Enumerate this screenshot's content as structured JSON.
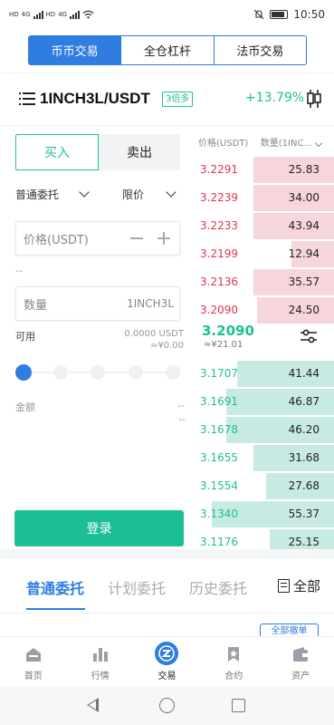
{
  "status_bar": {
    "left_tags": [
      "HD",
      "4G",
      "HD",
      "4G"
    ],
    "time": "10:50"
  },
  "top_tabs": [
    {
      "label": "币币交易",
      "active": true
    },
    {
      "label": "全仓杠杆",
      "active": false
    },
    {
      "label": "法币交易",
      "active": false
    }
  ],
  "pair": {
    "name": "1INCH3L/USDT",
    "leverage_badge": "3倍多",
    "change": "+13.79%"
  },
  "order_form": {
    "buy_label": "买入",
    "sell_label": "卖出",
    "order_type": "普通委托",
    "price_type": "限价",
    "price_placeholder": "价格(USDT)",
    "price_hint": "--",
    "amount_placeholder": "数量",
    "amount_unit": "1INCH3L",
    "available_label": "可用",
    "available_value": "0.0000 USDT",
    "available_cny": "≈¥0.00",
    "total_label": "金额",
    "total_value": "--",
    "total_sub": "--",
    "slider_position": 0,
    "login_label": "登录"
  },
  "order_book": {
    "header_price": "价格(USDT)",
    "header_qty": "数量(1INC...",
    "asks": [
      {
        "price": "3.2291",
        "qty": "25.83",
        "depth": 0.59
      },
      {
        "price": "3.2239",
        "qty": "34.00",
        "depth": 0.59
      },
      {
        "price": "3.2233",
        "qty": "43.94",
        "depth": 0.59
      },
      {
        "price": "3.2199",
        "qty": "12.94",
        "depth": 0.31
      },
      {
        "price": "3.2136",
        "qty": "35.57",
        "depth": 0.59
      },
      {
        "price": "3.2090",
        "qty": "24.50",
        "depth": 0.57
      }
    ],
    "last_price": "3.2090",
    "last_price_cny": "≈¥21.01",
    "bids": [
      {
        "price": "3.1707",
        "qty": "41.44",
        "depth": 0.71
      },
      {
        "price": "3.1691",
        "qty": "46.87",
        "depth": 0.79
      },
      {
        "price": "3.1678",
        "qty": "46.20",
        "depth": 0.79
      },
      {
        "price": "3.1655",
        "qty": "31.68",
        "depth": 0.59
      },
      {
        "price": "3.1554",
        "qty": "27.68",
        "depth": 0.5
      },
      {
        "price": "3.1340",
        "qty": "55.37",
        "depth": 0.9
      },
      {
        "price": "3.1176",
        "qty": "25.15",
        "depth": 0.47
      }
    ]
  },
  "order_tabs": {
    "items": [
      "普通委托",
      "计划委托",
      "历史委托"
    ],
    "active": 0,
    "all_label": "全部",
    "cancel_all_label": "全部撤单"
  },
  "bottom_nav": [
    {
      "label": "首页",
      "icon": "home-icon"
    },
    {
      "label": "行情",
      "icon": "market-chart-icon"
    },
    {
      "label": "交易",
      "icon": "trade-logo-icon",
      "active": true
    },
    {
      "label": "合约",
      "icon": "contract-icon"
    },
    {
      "label": "资产",
      "icon": "wallet-icon"
    }
  ],
  "colors": {
    "brand_blue": "#2f7de1",
    "buy_green": "#1dbf96",
    "sell_red": "#e0344e",
    "ask_depth": "#f7d6db",
    "bid_depth": "#c7ebe3"
  }
}
